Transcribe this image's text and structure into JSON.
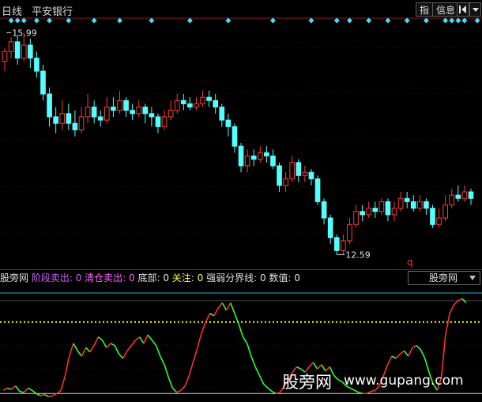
{
  "header": {
    "period": "日线",
    "stock_name": "平安银行"
  },
  "toolbar": {
    "indicator_button": "指",
    "info_button": "信息"
  },
  "colors": {
    "up": "#ff3a3a",
    "down": "#54ffff",
    "line_up": "#ff3030",
    "line_down": "#30ff30",
    "diamond": "#40e0ff",
    "ref_line": "#d9d9d9",
    "dotted": "#ffff00",
    "top_line": "#2bb0d0",
    "grid": "#5a0000"
  },
  "price_labels": {
    "high": "15.99",
    "low": "12.59",
    "marker_q": "q"
  },
  "indicator": {
    "name": "股旁网",
    "items": [
      {
        "label": "阶段卖出:",
        "value": "0",
        "color": "#d060ff"
      },
      {
        "label": "清仓卖出:",
        "value": "0",
        "color": "#ff60ff"
      },
      {
        "label": "底部:",
        "value": "0",
        "color": "#e0e0e0"
      },
      {
        "label": "关注:",
        "value": "0",
        "color": "#ffff40"
      },
      {
        "label": "强弱分界线:",
        "value": "0",
        "color": "#e0e0e0"
      },
      {
        "label": "数值:",
        "value": "0",
        "color": "#e0e0e0"
      }
    ],
    "selector_value": "股旁网"
  },
  "watermark": {
    "cn": "股旁网",
    "url": "www.gupang.com"
  },
  "chart_data": [
    {
      "type": "candlestick",
      "ylim": [
        12.4,
        16.2
      ],
      "high_label_value": 15.99,
      "low_label_value": 12.59,
      "diamond_positions": [
        1,
        2,
        3,
        5,
        7,
        10,
        14,
        18,
        23,
        29,
        35,
        42,
        48,
        52,
        54,
        57,
        60,
        63,
        66,
        69,
        70,
        71,
        72,
        74,
        81,
        85
      ],
      "candles": [
        [
          15.55,
          15.7,
          15.75,
          15.4
        ],
        [
          15.7,
          15.85,
          15.92,
          15.6
        ],
        [
          15.85,
          15.6,
          15.95,
          15.5
        ],
        [
          15.6,
          15.8,
          15.99,
          15.55
        ],
        [
          15.8,
          15.6,
          15.9,
          15.45
        ],
        [
          15.6,
          15.4,
          15.7,
          15.3
        ],
        [
          15.4,
          15.05,
          15.5,
          14.95
        ],
        [
          15.05,
          14.7,
          15.15,
          14.55
        ],
        [
          14.7,
          14.6,
          14.85,
          14.45
        ],
        [
          14.6,
          14.75,
          14.95,
          14.5
        ],
        [
          14.75,
          14.6,
          14.9,
          14.5
        ],
        [
          14.6,
          14.5,
          14.8,
          14.4
        ],
        [
          14.5,
          14.7,
          14.85,
          14.45
        ],
        [
          14.7,
          14.85,
          15.05,
          14.6
        ],
        [
          14.85,
          14.7,
          14.95,
          14.6
        ],
        [
          14.7,
          14.65,
          14.8,
          14.55
        ],
        [
          14.65,
          14.85,
          15.0,
          14.6
        ],
        [
          14.85,
          14.8,
          15.0,
          14.7
        ],
        [
          14.8,
          14.95,
          15.1,
          14.75
        ],
        [
          14.95,
          14.8,
          15.0,
          14.7
        ],
        [
          14.8,
          14.75,
          14.9,
          14.65
        ],
        [
          14.75,
          14.85,
          14.95,
          14.7
        ],
        [
          14.85,
          14.75,
          14.9,
          14.6
        ],
        [
          14.75,
          14.7,
          14.85,
          14.55
        ],
        [
          14.7,
          14.55,
          14.75,
          14.45
        ],
        [
          14.55,
          14.7,
          14.8,
          14.5
        ],
        [
          14.7,
          14.8,
          14.95,
          14.65
        ],
        [
          14.8,
          14.95,
          15.05,
          14.75
        ],
        [
          14.95,
          14.9,
          15.05,
          14.8
        ],
        [
          14.9,
          14.85,
          15.0,
          14.8
        ],
        [
          14.85,
          14.9,
          15.0,
          14.8
        ],
        [
          14.9,
          15.0,
          15.1,
          14.85
        ],
        [
          15.0,
          14.95,
          15.1,
          14.85
        ],
        [
          14.95,
          14.85,
          15.05,
          14.75
        ],
        [
          14.85,
          14.65,
          14.9,
          14.55
        ],
        [
          14.65,
          14.55,
          14.75,
          14.4
        ],
        [
          14.55,
          14.25,
          14.6,
          14.15
        ],
        [
          14.25,
          13.95,
          14.3,
          13.85
        ],
        [
          13.95,
          14.1,
          14.2,
          13.85
        ],
        [
          14.1,
          14.05,
          14.2,
          13.95
        ],
        [
          14.05,
          14.15,
          14.25,
          14.0
        ],
        [
          14.15,
          14.1,
          14.25,
          14.0
        ],
        [
          14.1,
          13.95,
          14.2,
          13.9
        ],
        [
          13.95,
          13.65,
          14.0,
          13.55
        ],
        [
          13.65,
          13.75,
          13.85,
          13.55
        ],
        [
          13.75,
          14.0,
          14.1,
          13.7
        ],
        [
          14.0,
          13.8,
          14.05,
          13.7
        ],
        [
          13.8,
          13.85,
          13.95,
          13.7
        ],
        [
          13.85,
          13.75,
          13.9,
          13.65
        ],
        [
          13.75,
          13.4,
          13.8,
          13.35
        ],
        [
          13.4,
          13.15,
          13.45,
          13.05
        ],
        [
          13.15,
          12.85,
          13.2,
          12.75
        ],
        [
          12.85,
          12.65,
          12.9,
          12.59
        ],
        [
          12.65,
          12.8,
          12.9,
          12.59
        ],
        [
          12.8,
          13.05,
          13.15,
          12.75
        ],
        [
          13.05,
          13.25,
          13.35,
          13.0
        ],
        [
          13.25,
          13.2,
          13.35,
          13.1
        ],
        [
          13.2,
          13.3,
          13.4,
          13.15
        ],
        [
          13.3,
          13.25,
          13.4,
          13.15
        ],
        [
          13.25,
          13.4,
          13.45,
          13.2
        ],
        [
          13.4,
          13.2,
          13.45,
          13.1
        ],
        [
          13.2,
          13.3,
          13.4,
          13.1
        ],
        [
          13.3,
          13.45,
          13.55,
          13.25
        ],
        [
          13.45,
          13.4,
          13.55,
          13.3
        ],
        [
          13.4,
          13.3,
          13.5,
          13.25
        ],
        [
          13.3,
          13.4,
          13.5,
          13.25
        ],
        [
          13.4,
          13.3,
          13.45,
          13.2
        ],
        [
          13.3,
          13.05,
          13.35,
          13.0
        ],
        [
          13.05,
          13.15,
          13.3,
          13.0
        ],
        [
          13.15,
          13.35,
          13.5,
          13.1
        ],
        [
          13.35,
          13.5,
          13.6,
          13.3
        ],
        [
          13.5,
          13.45,
          13.65,
          13.4
        ],
        [
          13.45,
          13.55,
          13.65,
          13.4
        ],
        [
          13.55,
          13.45,
          13.6,
          13.35
        ]
      ]
    },
    {
      "type": "line",
      "name": "股旁网",
      "ylim": [
        0,
        100
      ],
      "ref_levels": [
        5,
        10,
        28,
        50,
        72,
        92
      ],
      "values": [
        8,
        10,
        9,
        12,
        7,
        6,
        10,
        8,
        5,
        3,
        4,
        2,
        3,
        5,
        8,
        22,
        40,
        52,
        45,
        40,
        48,
        44,
        50,
        58,
        55,
        48,
        52,
        50,
        42,
        38,
        45,
        50,
        55,
        58,
        52,
        60,
        55,
        50,
        40,
        32,
        20,
        10,
        6,
        8,
        12,
        22,
        35,
        48,
        62,
        72,
        80,
        78,
        85,
        90,
        83,
        90,
        80,
        70,
        58,
        52,
        40,
        30,
        22,
        14,
        10,
        7,
        5,
        6,
        12,
        18,
        25,
        30,
        28,
        25,
        30,
        34,
        28,
        32,
        26,
        30,
        22,
        18,
        16,
        12,
        10,
        8,
        6,
        5,
        5,
        7,
        8,
        12,
        22,
        32,
        40,
        38,
        42,
        45,
        40,
        48,
        50,
        46,
        38,
        25,
        14,
        8,
        20,
        60,
        80,
        88,
        92,
        94,
        90
      ]
    }
  ]
}
